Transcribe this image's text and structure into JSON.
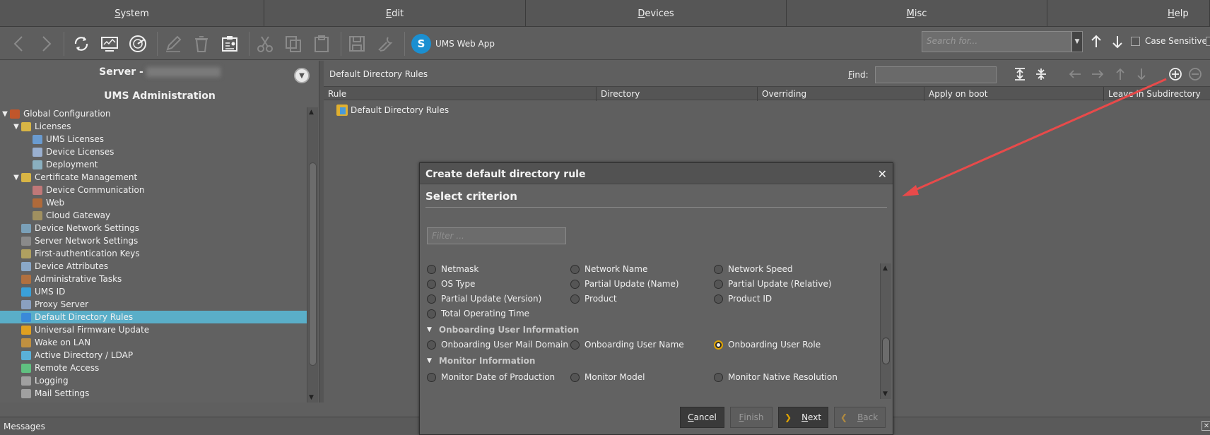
{
  "menu": {
    "items": [
      {
        "label": "System",
        "mnemonic": "S",
        "rest": "ystem"
      },
      {
        "label": "Edit",
        "mnemonic": "E",
        "rest": "dit"
      },
      {
        "label": "Devices",
        "mnemonic": "D",
        "rest": "evices"
      },
      {
        "label": "Misc",
        "mnemonic": "M",
        "rest": "isc"
      },
      {
        "label": "Help",
        "mnemonic": "H",
        "rest": "elp"
      }
    ]
  },
  "toolbar": {
    "webapp_label": "UMS Web App",
    "search_placeholder": "Search for...",
    "case_sensitive_label": "Case Sensitive"
  },
  "left": {
    "server_label": "Server -",
    "admin_title": "UMS Administration",
    "tree": [
      {
        "label": "Global Configuration",
        "level": 0,
        "twisty": "▼",
        "icon": "global-config-icon",
        "color": "#c0562b"
      },
      {
        "label": "Licenses",
        "level": 1,
        "twisty": "▼",
        "icon": "folder-icon",
        "color": "#d8b545"
      },
      {
        "label": "UMS Licenses",
        "level": 2,
        "twisty": "",
        "icon": "license-icon",
        "color": "#6a9bd0"
      },
      {
        "label": "Device Licenses",
        "level": 2,
        "twisty": "",
        "icon": "license-icon",
        "color": "#9ab0d0"
      },
      {
        "label": "Deployment",
        "level": 2,
        "twisty": "",
        "icon": "deployment-icon",
        "color": "#8ab0c0"
      },
      {
        "label": "Certificate Management",
        "level": 1,
        "twisty": "▼",
        "icon": "folder-icon",
        "color": "#d8b545"
      },
      {
        "label": "Device Communication",
        "level": 2,
        "twisty": "",
        "icon": "certificate-icon",
        "color": "#c07878"
      },
      {
        "label": "Web",
        "level": 2,
        "twisty": "",
        "icon": "certificate-icon",
        "color": "#b06a3a"
      },
      {
        "label": "Cloud Gateway",
        "level": 2,
        "twisty": "",
        "icon": "certificate-icon",
        "color": "#a09060"
      },
      {
        "label": "Device Network Settings",
        "level": 1,
        "twisty": "",
        "icon": "network-icon",
        "color": "#7aa0b8"
      },
      {
        "label": "Server Network Settings",
        "level": 1,
        "twisty": "",
        "icon": "server-icon",
        "color": "#8a8a8a"
      },
      {
        "label": "First-authentication Keys",
        "level": 1,
        "twisty": "",
        "icon": "key-icon",
        "color": "#b0a060"
      },
      {
        "label": "Device Attributes",
        "level": 1,
        "twisty": "",
        "icon": "monitor-icon",
        "color": "#8aa8c8"
      },
      {
        "label": "Administrative Tasks",
        "level": 1,
        "twisty": "",
        "icon": "tasks-icon",
        "color": "#b07040"
      },
      {
        "label": "UMS ID",
        "level": 1,
        "twisty": "",
        "icon": "ums-id-icon",
        "color": "#3aa0d8"
      },
      {
        "label": "Proxy Server",
        "level": 1,
        "twisty": "",
        "icon": "proxy-icon",
        "color": "#8aa0c0"
      },
      {
        "label": "Default Directory Rules",
        "level": 1,
        "twisty": "",
        "icon": "rules-icon",
        "color": "#3a8ad8",
        "selected": true
      },
      {
        "label": "Universal Firmware Update",
        "level": 1,
        "twisty": "",
        "icon": "firmware-icon",
        "color": "#e0a020"
      },
      {
        "label": "Wake on LAN",
        "level": 1,
        "twisty": "",
        "icon": "wake-icon",
        "color": "#c09040"
      },
      {
        "label": "Active Directory / LDAP",
        "level": 1,
        "twisty": "",
        "icon": "at-icon",
        "color": "#5ab0d8"
      },
      {
        "label": "Remote Access",
        "level": 1,
        "twisty": "",
        "icon": "remote-access-icon",
        "color": "#60c080"
      },
      {
        "label": "Logging",
        "level": 1,
        "twisty": "",
        "icon": "logging-icon",
        "color": "#a0a0a0"
      },
      {
        "label": "Mail Settings",
        "level": 1,
        "twisty": "",
        "icon": "mail-icon",
        "color": "#a0a0a0"
      }
    ]
  },
  "right": {
    "title": "Default Directory Rules",
    "find_label": "Find:",
    "find_mnemonic": "F",
    "find_rest": "ind:",
    "columns": [
      "Rule",
      "Directory",
      "Overriding",
      "Apply on boot",
      "Leave in Subdirectory"
    ],
    "row_label": "Default Directory Rules"
  },
  "messages": {
    "label": "Messages"
  },
  "dialog": {
    "title": "Create default directory rule",
    "subtitle": "Select criterion",
    "filter_placeholder": "Filter ...",
    "options_rows": [
      [
        "Netmask",
        "Network Name",
        "Network Speed"
      ],
      [
        "OS Type",
        "Partial Update (Name)",
        "Partial Update (Relative)"
      ],
      [
        "Partial Update (Version)",
        "Product",
        "Product ID"
      ],
      [
        "Total Operating Time",
        "",
        ""
      ]
    ],
    "group1": "Onboarding User Information",
    "group1_opts": [
      "Onboarding User Mail Domain",
      "Onboarding User Name",
      "Onboarding User Role"
    ],
    "group1_selected": "Onboarding User Role",
    "group2": "Monitor Information",
    "group2_opts": [
      "Monitor Date of Production",
      "Monitor Model",
      "Monitor Native Resolution"
    ],
    "buttons": {
      "cancel": {
        "label": "Cancel",
        "mn": "C",
        "rest": "ancel"
      },
      "finish": {
        "label": "Finish",
        "mn": "F",
        "rest": "inish"
      },
      "next": {
        "label": "Next",
        "mn": "N",
        "rest": "ext"
      },
      "back": {
        "label": "Back",
        "mn": "B",
        "rest": "ack"
      }
    }
  }
}
